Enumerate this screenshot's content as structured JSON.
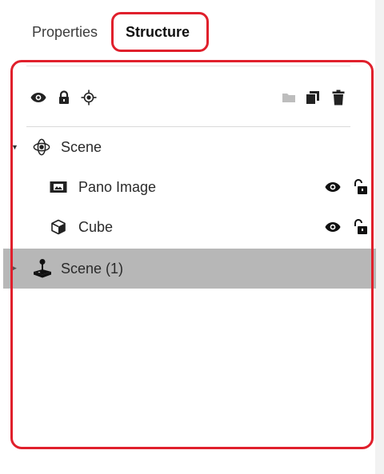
{
  "tabs": [
    {
      "label": "Properties",
      "active": false
    },
    {
      "label": "Structure",
      "active": true
    }
  ],
  "toolbar": {
    "left_icons": [
      "eye-icon",
      "lock-icon",
      "target-icon"
    ],
    "right_icons": [
      "folder-icon",
      "duplicate-icon",
      "trash-icon"
    ]
  },
  "tree": {
    "items": [
      {
        "label": "Scene",
        "icon": "scene-orbit-icon",
        "expanded": true,
        "level": 0
      },
      {
        "label": "Pano Image",
        "icon": "image-icon",
        "level": 1,
        "actions": [
          "eye-icon",
          "unlock-icon"
        ]
      },
      {
        "label": "Cube",
        "icon": "cube-icon",
        "level": 1,
        "actions": [
          "eye-icon",
          "unlock-icon"
        ]
      },
      {
        "label": "Scene (1)",
        "icon": "joystick-icon",
        "level": 0,
        "selected": true
      }
    ]
  },
  "colors": {
    "highlight": "#e0202c",
    "selected_row": "#b7b7b7",
    "icon_dark": "#222222",
    "icon_light": "#bdbdbd"
  }
}
